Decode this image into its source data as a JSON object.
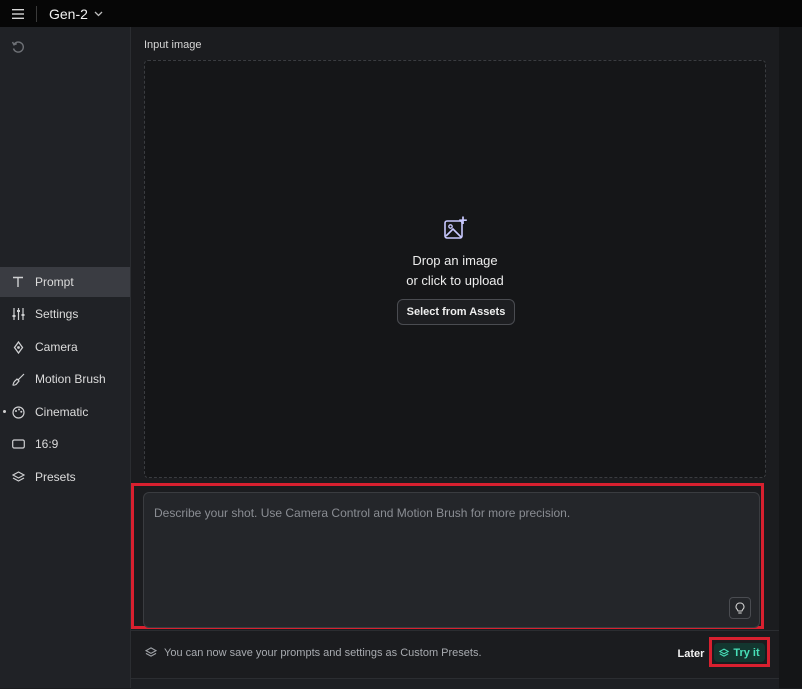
{
  "header": {
    "menu_icon": "menu-icon",
    "title": "Gen-2",
    "chevron_icon": "chevron-down-icon"
  },
  "sidebar": {
    "undo_icon": "undo-icon",
    "items": [
      {
        "label": "Prompt",
        "icon": "text-icon",
        "active": true
      },
      {
        "label": "Settings",
        "icon": "sliders-icon"
      },
      {
        "label": "Camera",
        "icon": "camera-move-icon"
      },
      {
        "label": "Motion Brush",
        "icon": "brush-icon"
      },
      {
        "label": "Cinematic",
        "icon": "palette-icon",
        "indicator_dot": true
      },
      {
        "label": "16:9",
        "icon": "aspect-ratio-icon"
      },
      {
        "label": "Presets",
        "icon": "layers-icon"
      }
    ]
  },
  "input_image": {
    "label": "Input image",
    "drop_line1": "Drop an image",
    "drop_line2": "or click to upload",
    "select_assets": "Select from Assets",
    "icon": "image-plus-icon"
  },
  "prompt": {
    "placeholder": "Describe your shot. Use Camera Control and Motion Brush for more precision.",
    "hint_icon": "lightbulb-icon"
  },
  "notice": {
    "text": "You can now save your prompts and settings as Custom Presets.",
    "icon": "layers-icon",
    "later": "Later",
    "try_it": "Try it"
  },
  "colors": {
    "accent": "#48e0b8",
    "highlight": "#d8202f"
  }
}
